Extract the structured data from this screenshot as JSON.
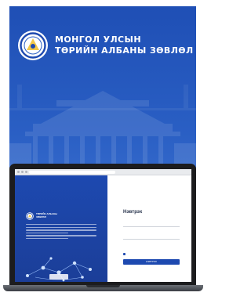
{
  "poster": {
    "title_line1": "МОНГОЛ УЛСЫН",
    "title_line2": "ТӨРИЙН АЛБАНЫ ЗӨВЛӨЛ"
  },
  "screen": {
    "left_panel": {
      "mini_title_line1": "ТӨРИЙН АЛБАНЫ",
      "mini_title_line2": "ЗӨВЛӨЛ"
    },
    "login": {
      "title": "Нэвтрэх",
      "username_placeholder": "",
      "password_placeholder": "",
      "button_label": "НЭВТРЭХ"
    }
  },
  "colors": {
    "brand_blue": "#1d49b0",
    "poster_blue": "#2a5fc4",
    "accent_yellow": "#ffd25a"
  }
}
